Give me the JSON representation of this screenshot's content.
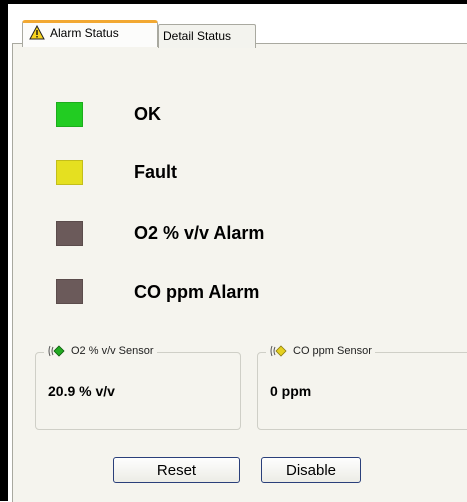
{
  "tabs": [
    {
      "label": "Alarm Status",
      "icon": "warning-icon",
      "active": true
    },
    {
      "label": "Detail Status",
      "active": false
    }
  ],
  "indicators": [
    {
      "label": "OK",
      "color": "#22cc22"
    },
    {
      "label": "Fault",
      "color": "#e5e020"
    },
    {
      "label": "O2 % v/v Alarm",
      "color": "#6b5a5a"
    },
    {
      "label": "CO ppm Alarm",
      "color": "#6b5a5a"
    }
  ],
  "sensors": [
    {
      "label": "O2 % v/v Sensor",
      "value": "20.9 % v/v",
      "icon_color": "#22aa22"
    },
    {
      "label": "CO ppm Sensor",
      "value": "0 ppm",
      "icon_color": "#e5d020"
    }
  ],
  "buttons": {
    "reset": "Reset",
    "disable": "Disable"
  },
  "colors": {
    "active_tab_accent": "#f2a832",
    "panel_bg": "#f5f4ee",
    "button_border": "#2a3f7a"
  }
}
